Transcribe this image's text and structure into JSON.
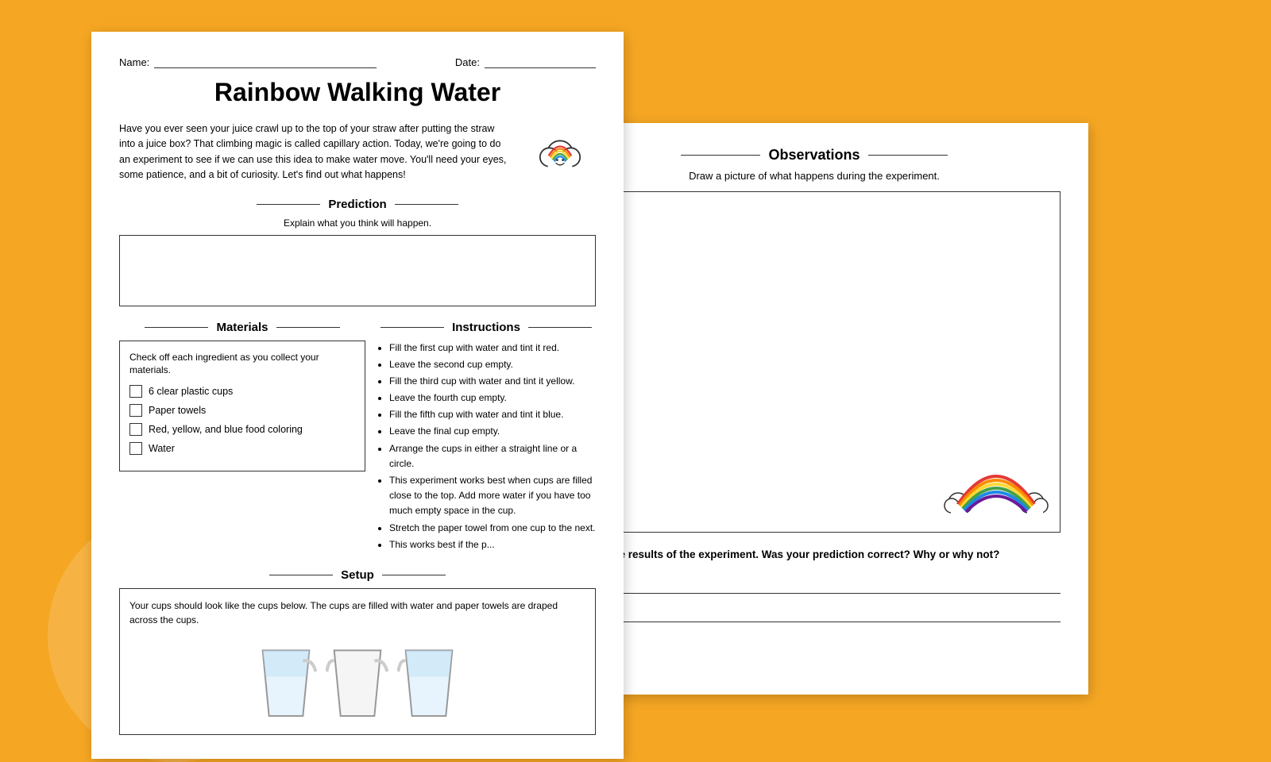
{
  "background_color": "#F5A623",
  "page1": {
    "name_label": "Name:",
    "date_label": "Date:",
    "title": "Rainbow Walking Water",
    "intro": "Have you ever seen your juice crawl up to the top of your straw after putting the straw into a juice box? That climbing magic is called capillary action. Today, we're going to do an experiment to see if we can use this idea to make water move. You'll need your eyes, some patience, and a bit of curiosity. Let's find out what happens!",
    "prediction": {
      "heading": "Prediction",
      "subtitle": "Explain what you think will happen."
    },
    "materials": {
      "heading": "Materials",
      "collect_text": "Check off each ingredient as you collect your materials.",
      "items": [
        "6 clear plastic cups",
        "Paper towels",
        "Red, yellow, and blue food coloring",
        "Water"
      ]
    },
    "instructions": {
      "heading": "Instructions",
      "items": [
        "Fill the first cup with water and tint it red.",
        "Leave the second cup empty.",
        "Fill the third cup with water and tint it yellow.",
        "Leave the fourth cup empty.",
        "Fill the fifth cup with water and tint it blue.",
        "Leave the final cup empty.",
        "Arrange the cups in either a straight line or a circle.",
        "This experiment works best when cups are filled close to the top. Add more water if you have too much empty space in the cup.",
        "Stretch the paper towel from one cup to the next.",
        "This works best if the paper towel..."
      ]
    },
    "setup": {
      "heading": "Setup",
      "text": "Your cups should look like the cups below. The cups are filled with water and paper towels are draped across the cups."
    }
  },
  "page2": {
    "observations": {
      "heading": "Observations",
      "subtitle": "Draw a picture of what happens during the experiment."
    },
    "results_question": "Explain the results of the experiment. Was your prediction correct? Why or why not?"
  }
}
